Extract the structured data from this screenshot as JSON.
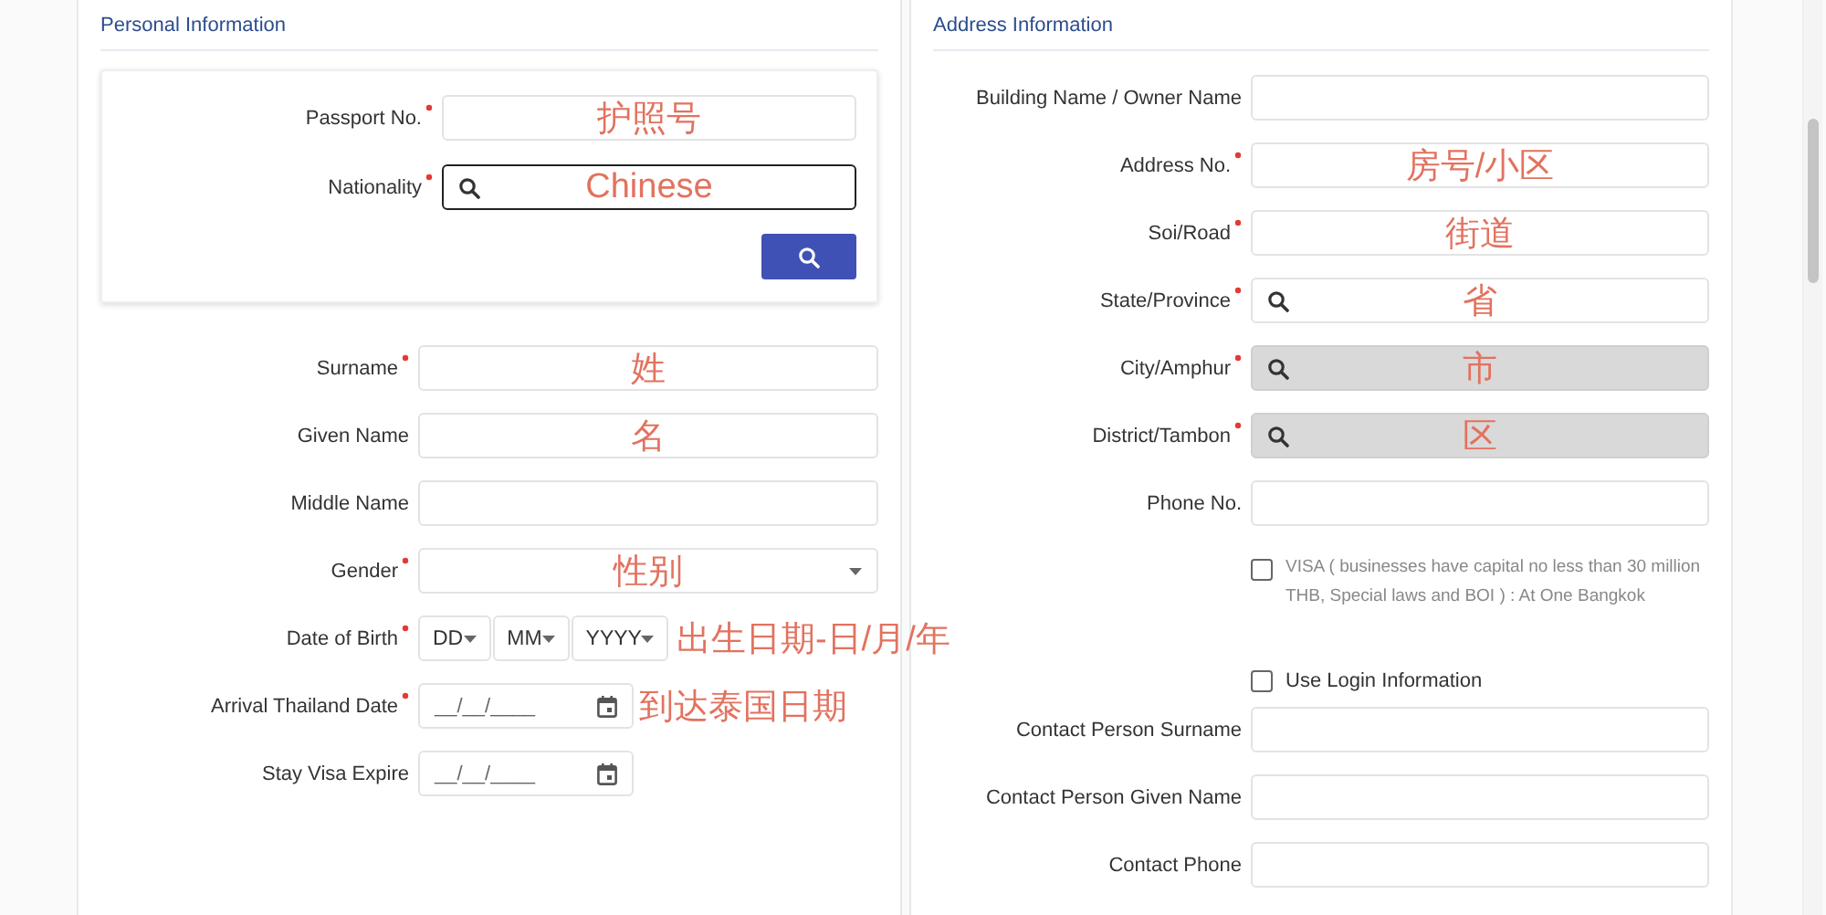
{
  "personal": {
    "title": "Personal Information",
    "lookup": {
      "fields": [
        {
          "label": "Passport No.",
          "required": true,
          "kind": "text",
          "focused": false,
          "note": "护照号"
        },
        {
          "label": "Nationality",
          "required": true,
          "kind": "search",
          "focused": true,
          "note": "Chinese"
        }
      ]
    },
    "fields": [
      {
        "label": "Surname",
        "required": true,
        "kind": "text",
        "note": "姓"
      },
      {
        "label": "Given Name",
        "required": false,
        "kind": "text",
        "note": "名"
      },
      {
        "label": "Middle Name",
        "required": false,
        "kind": "text"
      },
      {
        "label": "Gender",
        "required": true,
        "kind": "select",
        "note": "性别"
      },
      {
        "label": "Date of Birth",
        "required": true,
        "kind": "parts",
        "parts": [
          "DD",
          "MM",
          "YYYY"
        ],
        "note": "出生日期-日/月/年"
      },
      {
        "label": "Arrival Thailand Date",
        "required": true,
        "kind": "date",
        "placeholder": "__/__/____",
        "note": "到达泰国日期"
      },
      {
        "label": "Stay Visa Expire",
        "required": false,
        "kind": "date",
        "placeholder": "__/__/____"
      }
    ]
  },
  "address": {
    "title": "Address Information",
    "fields": [
      {
        "label": "Building Name / Owner Name",
        "required": false,
        "kind": "text",
        "disabled": false
      },
      {
        "label": "Address No.",
        "required": true,
        "kind": "text",
        "disabled": false,
        "note": "房号/小区"
      },
      {
        "label": "Soi/Road",
        "required": true,
        "kind": "text",
        "disabled": false,
        "note": "街道"
      },
      {
        "label": "State/Province",
        "required": true,
        "kind": "search",
        "disabled": false,
        "note": "省"
      },
      {
        "label": "City/Amphur",
        "required": true,
        "kind": "search",
        "disabled": true,
        "note": "市"
      },
      {
        "label": "District/Tambon",
        "required": true,
        "kind": "search",
        "disabled": true,
        "note": "区"
      },
      {
        "label": "Phone No.",
        "required": false,
        "kind": "text",
        "disabled": false
      }
    ],
    "checkboxes": [
      {
        "label": "VISA ( businesses have capital no less than 30 million THB, Special laws and BOI ) : At One Bangkok",
        "checked": false,
        "muted": true
      },
      {
        "label": "Use Login Information",
        "checked": false,
        "muted": false
      }
    ],
    "contact_fields": [
      {
        "label": "Contact Person Surname",
        "required": false,
        "kind": "text",
        "disabled": false
      },
      {
        "label": "Contact Person Given Name",
        "required": false,
        "kind": "text",
        "disabled": false
      },
      {
        "label": "Contact Phone",
        "required": false,
        "kind": "text",
        "disabled": false
      }
    ]
  }
}
